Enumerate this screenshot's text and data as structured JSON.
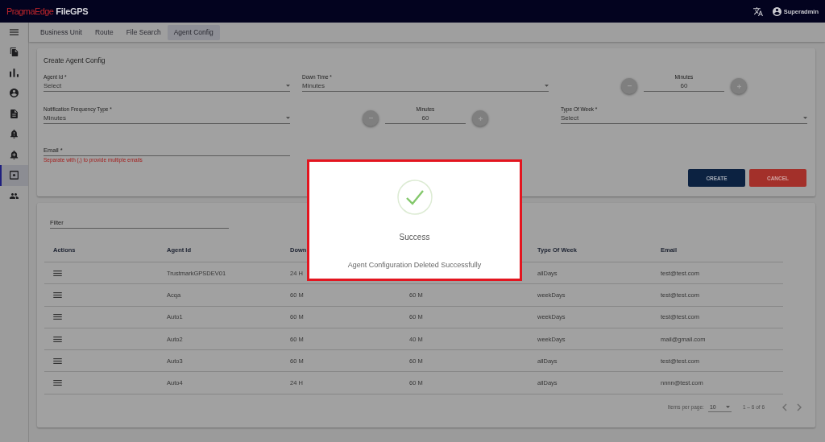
{
  "app_bar": {
    "logo": {
      "brand": "PragmaEdge",
      "product": "FileGPS"
    },
    "user": "Superadmin"
  },
  "sidebar": {
    "items": [
      {
        "selected": false
      },
      {
        "selected": false
      },
      {
        "selected": false
      },
      {
        "selected": false
      },
      {
        "selected": false
      },
      {
        "selected": false
      },
      {
        "selected": true
      },
      {
        "selected": false
      }
    ]
  },
  "tabs": [
    {
      "label": "Business Unit",
      "selected": false
    },
    {
      "label": "Route",
      "selected": false
    },
    {
      "label": "File Search",
      "selected": false
    },
    {
      "label": "Agent Config",
      "selected": true
    }
  ],
  "form": {
    "title": "Create Agent Config",
    "fields": [
      {
        "kind": "select",
        "label": "Agent Id *",
        "value": "Select"
      },
      {
        "kind": "select",
        "label": "Down Time *",
        "value": "Minutes"
      },
      {
        "kind": "stepper",
        "label": "Minutes",
        "value": "60"
      },
      {
        "kind": "select",
        "label": "Notification Frequency Type *",
        "value": "Minutes"
      },
      {
        "kind": "stepper",
        "label": "Minutes",
        "value": "60"
      },
      {
        "kind": "select",
        "label": "Type Of Week *",
        "value": "Select"
      },
      {
        "kind": "text",
        "label": "Email *",
        "hint": "Separate with (,) to provide multiple emails"
      }
    ],
    "buttons": [
      {
        "kind": "primary",
        "label": "CREATE"
      },
      {
        "kind": "warn",
        "label": "CANCEL"
      }
    ]
  },
  "table": {
    "filter": {
      "placeholder": "Filter"
    },
    "columns": [
      "Actions",
      "Agent Id",
      "Down",
      "Type Of Week",
      "Email"
    ],
    "rows": [
      {
        "agent_id": "TrustmarkGPSDEV01",
        "down_time": "24 H",
        "type_of_week": "allDays",
        "email": "test@test.com"
      },
      {
        "agent_id": "Acqa",
        "down_time": "60 M",
        "column_4": "60 M",
        "type_of_week": "weekDays",
        "email": "test@test.com"
      },
      {
        "agent_id": "Auto1",
        "down_time": "60 M",
        "column_4": "60 M",
        "type_of_week": "weekDays",
        "email": "test@test.com"
      },
      {
        "agent_id": "Auto2",
        "down_time": "60 M",
        "column_4": "40 M",
        "type_of_week": "weekDays",
        "email": "mail@gmail.com"
      },
      {
        "agent_id": "Auto3",
        "down_time": "60 M",
        "column_4": "60 M",
        "type_of_week": "allDays",
        "email": "test@test.com"
      },
      {
        "agent_id": "Auto4",
        "down_time": "24 H",
        "column_4": "60 M",
        "type_of_week": "allDays",
        "email": "nnnn@test.com"
      }
    ]
  },
  "paginator": {
    "label": "Items per page:",
    "page_size": "10",
    "range": "1 – 6 of 6"
  },
  "dialog": {
    "title": "Success",
    "message": "Agent Configuration Deleted Successfully"
  }
}
